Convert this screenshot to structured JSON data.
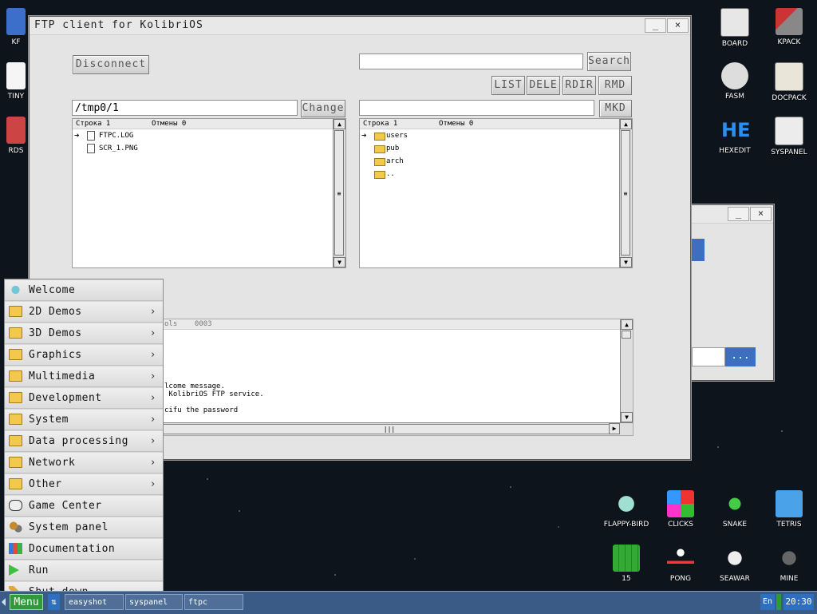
{
  "ftp_window": {
    "title": "FTP client for KolibriOS",
    "minimize_label": "_",
    "close_label": "×",
    "disconnect_label": "Disconnect",
    "search_label": "Search",
    "search_value": "",
    "list_label": "LIST",
    "dele_label": "DELE",
    "rdir_label": "RDIR",
    "rmd_label": "RMD",
    "local_path": "/tmp0/1",
    "change_label": "Change",
    "remote_path": "",
    "mkd_label": "MKD",
    "local_panel": {
      "header_row": "Строка 1",
      "header_cancel": "Отмены 0",
      "files": [
        "FTPC.LOG",
        "SCR_1.PNG"
      ]
    },
    "remote_panel": {
      "header_row": "Строка 1",
      "header_cancel": "Отмены 0",
      "folders": [
        "users",
        "pub",
        "arch",
        ".."
      ]
    },
    "log": {
      "header": "ols    0003",
      "lines": [
        "lcome message.",
        " KolibriOS FTP service.",
        "",
        "cifu the password"
      ]
    }
  },
  "small_window": {
    "minimize_label": "_",
    "close_label": "×",
    "dots_label": "..."
  },
  "desktop_icons": {
    "board": "BOARD",
    "kpack": "KPACK",
    "fasm": "FASM",
    "docpack": "DOCPACK",
    "hexedit": "HEXEDIT",
    "syspanel": "SYSPANEL",
    "flappy": "FLAPPY-BIRD",
    "clicks": "CLICKS",
    "snake": "SNAKE",
    "tetris": "TETRIS",
    "fifteen": "15",
    "pong": "PONG",
    "seawar": "SEAWAR",
    "mine": "MINE",
    "left_kf": "KF",
    "left_tiny": "TINY",
    "left_rds": "RDS"
  },
  "start_menu": {
    "items": [
      {
        "label": "Welcome",
        "icon": "bird-icon"
      },
      {
        "label": "2D Demos",
        "icon": "folder-icon",
        "submenu": true
      },
      {
        "label": "3D Demos",
        "icon": "folder-icon",
        "submenu": true
      },
      {
        "label": "Graphics",
        "icon": "folder-icon",
        "submenu": true
      },
      {
        "label": "Multimedia",
        "icon": "folder-icon",
        "submenu": true
      },
      {
        "label": "Development",
        "icon": "folder-icon",
        "submenu": true
      },
      {
        "label": "System",
        "icon": "folder-icon",
        "submenu": true
      },
      {
        "label": "Data processing",
        "icon": "folder-icon",
        "submenu": true
      },
      {
        "label": "Network",
        "icon": "folder-icon",
        "submenu": true
      },
      {
        "label": "Other",
        "icon": "folder-icon",
        "submenu": true
      },
      {
        "label": "Game Center",
        "icon": "gamepad-icon"
      },
      {
        "label": "System panel",
        "icon": "gears-icon"
      },
      {
        "label": "Documentation",
        "icon": "books-icon"
      },
      {
        "label": "Run",
        "icon": "play-icon"
      },
      {
        "label": "Shut down",
        "icon": "pencil-icon"
      }
    ],
    "chevron": "›"
  },
  "taskbar": {
    "menu_label": "Menu",
    "switch_label": "⇅",
    "tasks": [
      "easyshot",
      "syspanel",
      "ftpc"
    ],
    "lang": "En",
    "clock": "20:30"
  }
}
